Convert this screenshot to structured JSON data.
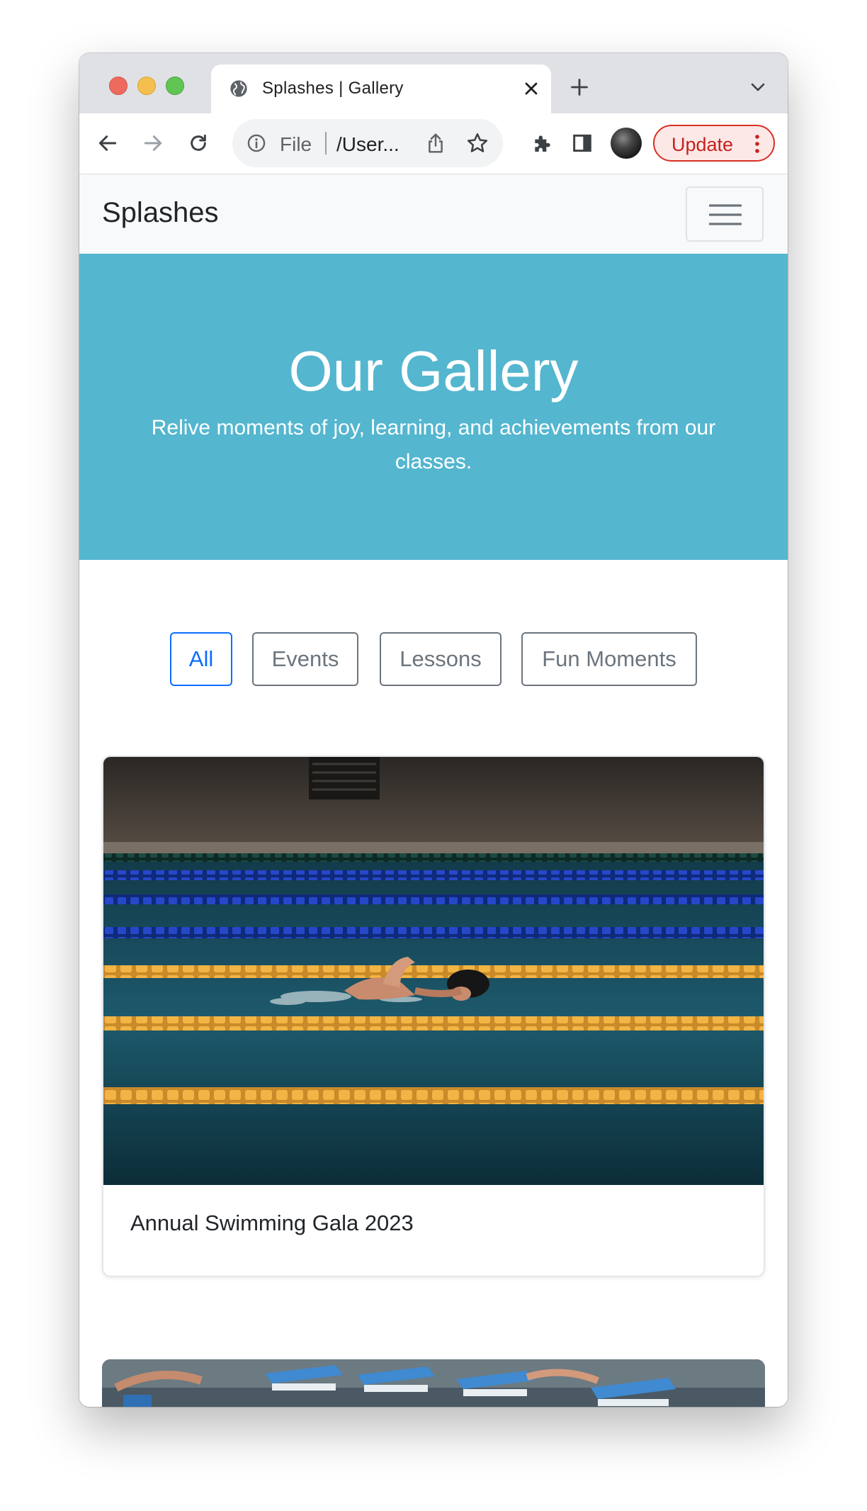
{
  "browser": {
    "tab_title": "Splashes | Gallery",
    "omnibox_scheme": "File",
    "omnibox_url": "/User...",
    "update_label": "Update"
  },
  "navbar": {
    "brand": "Splashes"
  },
  "hero": {
    "title": "Our Gallery",
    "subtitle": "Relive moments of joy, learning, and achievements from our classes.",
    "background_color": "#54b6cf"
  },
  "filters": {
    "buttons": [
      "All",
      "Events",
      "Lessons",
      "Fun Moments"
    ],
    "active": "All"
  },
  "gallery": {
    "items": [
      {
        "title": "Annual Swimming Gala 2023",
        "image": "swimmer-freestyle-pool-photo"
      },
      {
        "title": "",
        "image": "swim-start-blocks-photo"
      }
    ]
  },
  "colors": {
    "accent": "#0d6efd",
    "update_red": "#c5221f"
  }
}
